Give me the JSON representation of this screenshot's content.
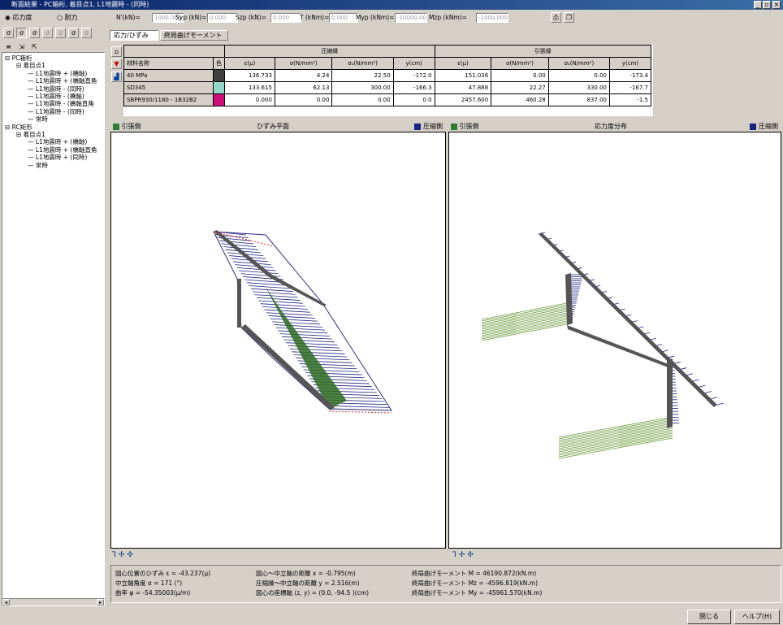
{
  "window": {
    "title": "断面結果 - PC箱桁, 着目点1, L1地震時 - (同時)",
    "min": "_",
    "max": "▫",
    "close": "×"
  },
  "toolbar": {
    "radio_stress": "応力度",
    "radio_strength": "耐力",
    "forces": [
      {
        "label": "N'(kN)=",
        "value": "1000.000"
      },
      {
        "label": "Syp (kN)=",
        "value": "0.000"
      },
      {
        "label": "Szp (kN)=",
        "value": "0.000"
      },
      {
        "label": "T (kNm)=",
        "value": "0.000"
      },
      {
        "label": "Myp (kNm)=",
        "value": "-10000.00"
      },
      {
        "label": "Mzp (kNm)=",
        "value": "-1000.000"
      }
    ]
  },
  "tabs": [
    "応力/ひずみ",
    "終局曲げモーメント"
  ],
  "tree": [
    {
      "t": "PC箱桁",
      "d": 0
    },
    {
      "t": "着目点1",
      "d": 1
    },
    {
      "t": "L1地震時 + (橋軸)",
      "d": 2
    },
    {
      "t": "L1地震時 + (橋軸直角",
      "d": 2
    },
    {
      "t": "L1地震時 - (同時)",
      "d": 2
    },
    {
      "t": "L1地震時 - (橋軸)",
      "d": 2
    },
    {
      "t": "L1地震時 - (橋軸直角",
      "d": 2
    },
    {
      "t": "L1地震時 - (同時)",
      "d": 2
    },
    {
      "t": "常時",
      "d": 2
    },
    {
      "t": "RC矩形",
      "d": 0
    },
    {
      "t": "着目点1",
      "d": 1
    },
    {
      "t": "L1地震時 + (橋軸)",
      "d": 2
    },
    {
      "t": "L1地震時 + (橋軸直角",
      "d": 2
    },
    {
      "t": "L1地震時 + (同時)",
      "d": 2
    },
    {
      "t": "常時",
      "d": 2
    }
  ],
  "table": {
    "group_comp": "圧縮縁",
    "group_tens": "引張縁",
    "h_name": "材料名称",
    "h_color": "色",
    "cols": [
      "ε(μ)",
      "σ(N/mm²)",
      "σₐ(N/mm²)",
      "y(cm)",
      "ε(μ)",
      "σ(N/mm²)",
      "σₐ(N/mm²)",
      "y(cm)"
    ],
    "rows": [
      {
        "name": "40 MPa",
        "color": "#404040",
        "v": [
          "136.733",
          "4.24",
          "22.50",
          "-172.0",
          "151.036",
          "0.00",
          "0.00",
          "-173.4"
        ]
      },
      {
        "name": "SD345",
        "color": "#90d8c8",
        "v": [
          "133.615",
          "62.13",
          "300.00",
          "-166.3",
          "47.888",
          "22.27",
          "330.00",
          "-167.7"
        ]
      },
      {
        "name": "SBPR930/1180 - 1B32B2",
        "color": "#d0107a",
        "v": [
          "0.000",
          "0.00",
          "0.00",
          "0.0",
          "2457.600",
          "460.28",
          "837.00",
          "-1.5"
        ]
      }
    ]
  },
  "left_panel": {
    "title": "ひずみ平面",
    "tension": "引張側",
    "compression": "圧縮側"
  },
  "right_panel": {
    "title": "応力度分布",
    "tension": "引張側",
    "compression": "圧縮側"
  },
  "status": {
    "c1": [
      "図心位置のひずみ ε = -43.237(μ)",
      "中立軸角度 α = 171 (°)",
      "曲率 φ = -54.35003(μ/m)"
    ],
    "c2": [
      "図心〜中立軸の距離 x = -0.795(m)",
      "圧縮縁〜中立軸の距離 y = 2.516(m)",
      "図心の座標軸 (z, y) = (0.0, -94.5 )(cm)"
    ],
    "c3": [
      "終局曲げモーメント M = 46190.872(kN.m)",
      "終局曲げモーメント Mz = -4596.819(kN.m)",
      "終局曲げモーメント My = -45961.570(kN.m)"
    ]
  },
  "buttons": {
    "close": "閉じる",
    "help": "ヘルプ(H)"
  },
  "colors": {
    "tension": "#2e7d32",
    "compression": "#1a237e"
  }
}
